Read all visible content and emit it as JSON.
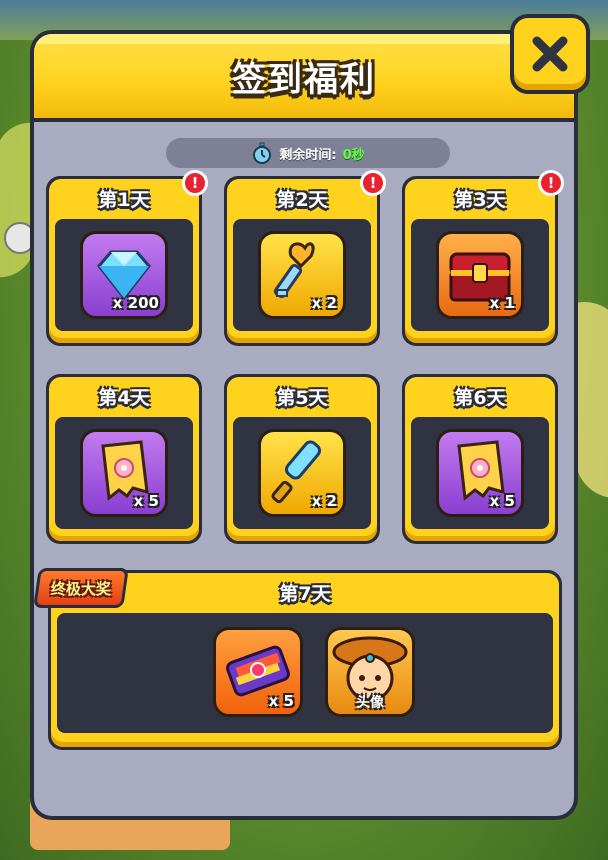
{
  "dialog": {
    "title": "签到福利",
    "close_icon": "close-icon",
    "timer": {
      "label": "剩余时间:",
      "value": "0秒",
      "icon": "stopwatch-icon"
    }
  },
  "days": [
    {
      "label": "第1天",
      "item": "diamond-icon",
      "qty": "x 200",
      "bg": "#a65be0",
      "alert": "!"
    },
    {
      "label": "第2天",
      "item": "key-icon",
      "qty": "x 2",
      "bg": "#ffc81a",
      "alert": "!"
    },
    {
      "label": "第3天",
      "item": "treasure-chest-icon",
      "qty": "x 1",
      "bg": "#f58a2a",
      "alert": "!"
    },
    {
      "label": "第4天",
      "item": "ticket-icon",
      "qty": "x 5",
      "bg": "#a65be0"
    },
    {
      "label": "第5天",
      "item": "magnifier-icon",
      "qty": "x 2",
      "bg": "#ffc81a"
    },
    {
      "label": "第6天",
      "item": "ticket-icon",
      "qty": "x 5",
      "bg": "#a65be0"
    }
  ],
  "grand_prize": {
    "tag": "终极大奖",
    "label": "第7天",
    "items": [
      {
        "item": "rainbow-ticket-icon",
        "qty": "x 5",
        "bg": "#ff7a1a"
      },
      {
        "item": "avatar-icon",
        "label": "头像",
        "bg": "#ffb030"
      }
    ]
  },
  "colors": {
    "accent_yellow": "#ffd21d",
    "panel_bg": "#a9acc1",
    "slot_bg": "#2f3342",
    "alert_red": "#e8232f",
    "timer_green": "#5dff3a"
  }
}
